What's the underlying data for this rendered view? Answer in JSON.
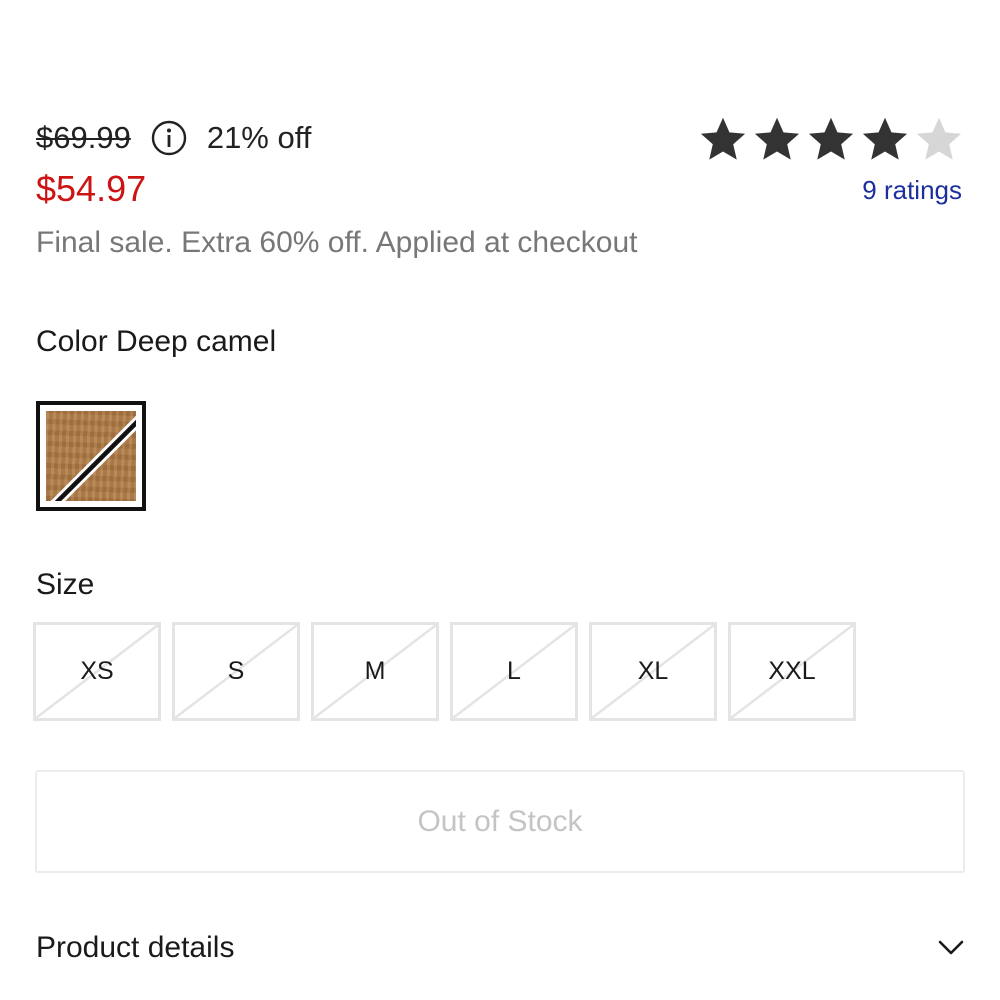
{
  "pricing": {
    "original_price": "$69.99",
    "discount_label": "21% off",
    "sale_price": "$54.97",
    "promo_text": "Final sale. Extra 60% off. Applied at checkout",
    "sale_color": "#cc1414"
  },
  "rating": {
    "stars_filled": 4,
    "stars_total": 5,
    "ratings_link": "9 ratings",
    "star_color": "#333333",
    "empty_star_color": "#d6d6d6"
  },
  "color": {
    "label": "Color Deep camel",
    "selected_swatch": "deep-camel",
    "swatch_color": "#b07a45"
  },
  "size": {
    "label": "Size",
    "options": [
      "XS",
      "S",
      "M",
      "L",
      "XL",
      "XXL"
    ],
    "all_unavailable": true
  },
  "cta": {
    "label": "Out of Stock",
    "disabled": true
  },
  "details": {
    "title": "Product details",
    "icon": "chevron-down-icon"
  }
}
